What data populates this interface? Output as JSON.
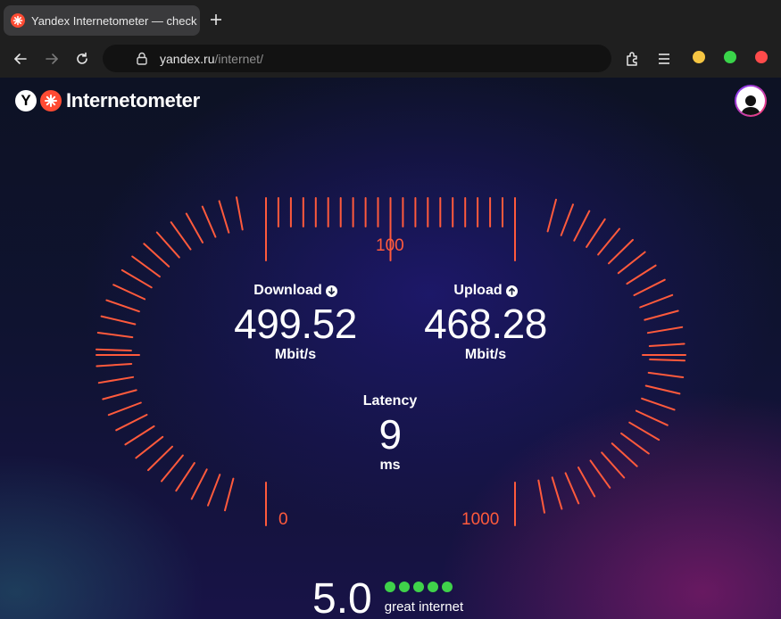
{
  "browser": {
    "tab": {
      "title": "Yandex Internetometer — check your internet speed"
    },
    "address": {
      "host": "yandex.ru",
      "path": "/internet/"
    },
    "window_controls": {
      "minimize_color": "#f5c542",
      "maximize_color": "#3ad44a",
      "close_color": "#ff4b4b"
    }
  },
  "page": {
    "logo": {
      "letter": "Y",
      "text": "Internetometer"
    },
    "download": {
      "label": "Download",
      "value": "499.52",
      "unit": "Mbit/s"
    },
    "upload": {
      "label": "Upload",
      "value": "468.28",
      "unit": "Mbit/s"
    },
    "latency": {
      "label": "Latency",
      "value": "9",
      "unit": "ms"
    },
    "scale": {
      "top": "100",
      "left": "0",
      "right": "1000"
    },
    "rating": {
      "score": "5.0",
      "dots_filled": 5,
      "text": "great internet"
    },
    "accent_color": "#ff5a3c"
  }
}
